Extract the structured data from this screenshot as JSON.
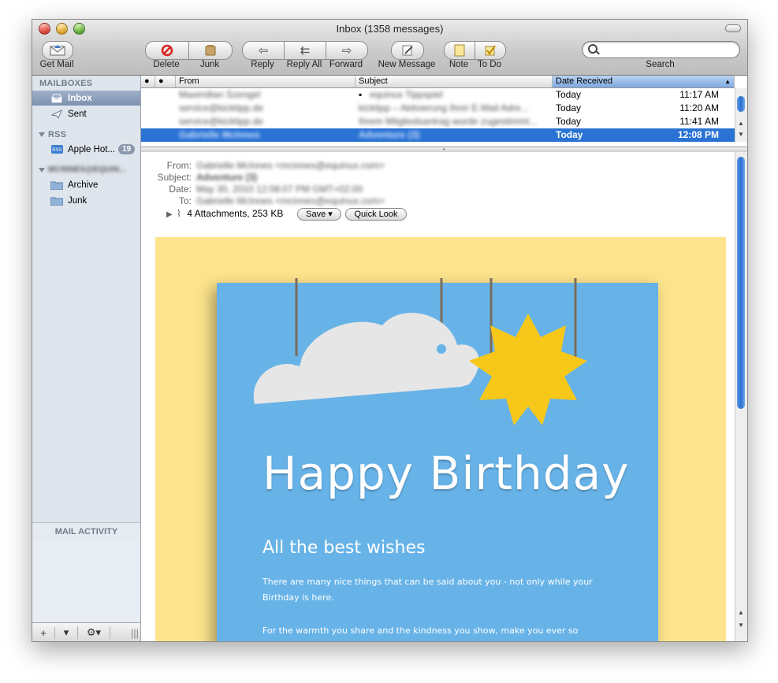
{
  "window": {
    "title": "Inbox (1358 messages)"
  },
  "toolbar": {
    "get_mail": "Get Mail",
    "delete": "Delete",
    "junk": "Junk",
    "reply": "Reply",
    "reply_all": "Reply All",
    "forward": "Forward",
    "new_message": "New Message",
    "note": "Note",
    "todo": "To Do",
    "search_label": "Search",
    "search_value": ""
  },
  "sidebar": {
    "mailboxes_header": "MAILBOXES",
    "inbox": "Inbox",
    "sent": "Sent",
    "rss_header": "RSS",
    "rss_feed": "Apple Hot...",
    "rss_badge": "19",
    "account_header": "MCINNES@EQUIN...",
    "archive": "Archive",
    "junk": "Junk",
    "activity_header": "MAIL ACTIVITY"
  },
  "message_list": {
    "columns": {
      "dot": "●",
      "flag": "●",
      "from": "From",
      "subject": "Subject",
      "date": "Date Received"
    },
    "rows": [
      {
        "from": "Maximilian Szengel",
        "subject": "equinux Tippspiel",
        "date": "Today",
        "time": "11:17 AM",
        "selected": false
      },
      {
        "from": "service@kicktipp.de",
        "subject": "kicktipp – Aktivierung Ihrer E-Mail Adre...",
        "date": "Today",
        "time": "11:20 AM",
        "selected": false
      },
      {
        "from": "service@kicktipp.de",
        "subject": "Ihrem Mitgliedsantrag wurde zugestimmt...",
        "date": "Today",
        "time": "11:41 AM",
        "selected": false
      },
      {
        "from": "Gabrielle McInnes",
        "subject": "Adventure (3)",
        "date": "Today",
        "time": "12:08 PM",
        "selected": true
      }
    ]
  },
  "message": {
    "from_label": "From:",
    "from_value": "Gabrielle McInnes <mcinnes@equinux.com>",
    "subject_label": "Subject:",
    "subject_value": "Adventure (3)",
    "date_label": "Date:",
    "date_value": "May 30, 2010 12:08:07 PM GMT+02:00",
    "to_label": "To:",
    "to_value": "Gabrielle McInnes <mcinnes@equinux.com>",
    "attachments": "4 Attachments, 253 KB",
    "save_button": "Save ▾",
    "quick_look_button": "Quick Look"
  },
  "card": {
    "title": "Happy Birthday",
    "subtitle": "All the best wishes",
    "line1": "There are many nice things that can be said about you - not only while your Birthday is here.",
    "line2": "For the warmth you share and the kindness you show, make you ever so special every"
  },
  "colors": {
    "selection": "#2a73d4",
    "card_blue": "#67b3e8",
    "card_yellow": "#fde48c",
    "sun": "#f7c81a"
  }
}
